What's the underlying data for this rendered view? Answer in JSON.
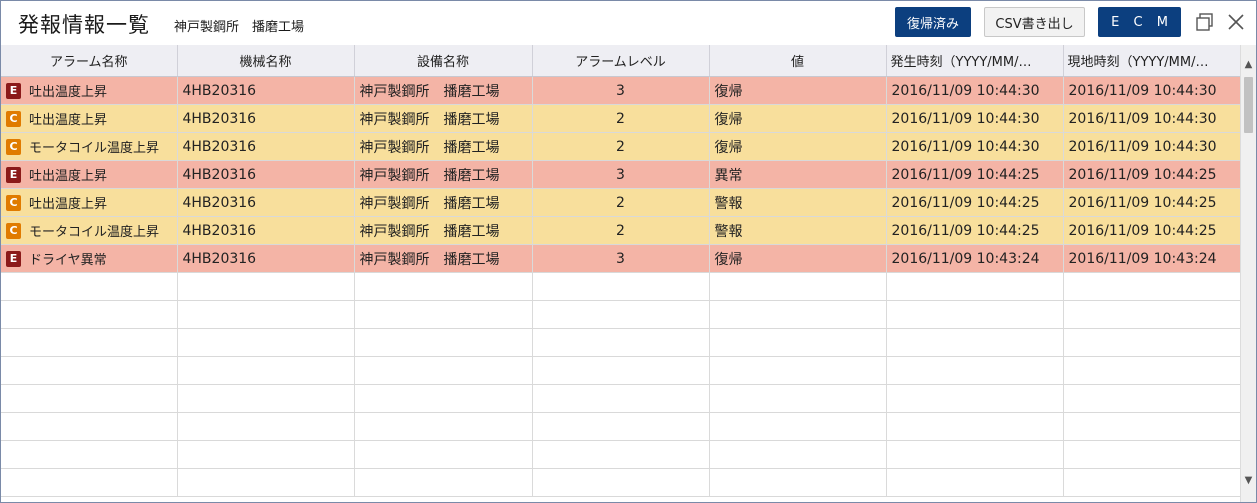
{
  "header": {
    "title": "発報情報一覧",
    "subtitle": "神戸製鋼所　播磨工場",
    "restored_button": "復帰済み",
    "csv_button": "CSV書き出し",
    "ecm": [
      "E",
      "C",
      "M"
    ]
  },
  "columns": [
    "アラーム名称",
    "機械名称",
    "設備名称",
    "アラームレベル",
    "値",
    "発生時刻（YYYY/MM/…",
    "現地時刻（YYYY/MM/…"
  ],
  "rows": [
    {
      "badge": "E",
      "alarm": "吐出温度上昇",
      "machine": "4HB20316",
      "facility": "神戸製鋼所　播磨工場",
      "level": "3",
      "value": "復帰",
      "occurred": "2016/11/09 10:44:30",
      "local": "2016/11/09 10:44:30"
    },
    {
      "badge": "C",
      "alarm": "吐出温度上昇",
      "machine": "4HB20316",
      "facility": "神戸製鋼所　播磨工場",
      "level": "2",
      "value": "復帰",
      "occurred": "2016/11/09 10:44:30",
      "local": "2016/11/09 10:44:30"
    },
    {
      "badge": "C",
      "alarm": "モータコイル温度上昇",
      "machine": "4HB20316",
      "facility": "神戸製鋼所　播磨工場",
      "level": "2",
      "value": "復帰",
      "occurred": "2016/11/09 10:44:30",
      "local": "2016/11/09 10:44:30"
    },
    {
      "badge": "E",
      "alarm": "吐出温度上昇",
      "machine": "4HB20316",
      "facility": "神戸製鋼所　播磨工場",
      "level": "3",
      "value": "異常",
      "occurred": "2016/11/09 10:44:25",
      "local": "2016/11/09 10:44:25"
    },
    {
      "badge": "C",
      "alarm": "吐出温度上昇",
      "machine": "4HB20316",
      "facility": "神戸製鋼所　播磨工場",
      "level": "2",
      "value": "警報",
      "occurred": "2016/11/09 10:44:25",
      "local": "2016/11/09 10:44:25"
    },
    {
      "badge": "C",
      "alarm": "モータコイル温度上昇",
      "machine": "4HB20316",
      "facility": "神戸製鋼所　播磨工場",
      "level": "2",
      "value": "警報",
      "occurred": "2016/11/09 10:44:25",
      "local": "2016/11/09 10:44:25"
    },
    {
      "badge": "E",
      "alarm": "ドライヤ異常",
      "machine": "4HB20316",
      "facility": "神戸製鋼所　播磨工場",
      "level": "3",
      "value": "復帰",
      "occurred": "2016/11/09 10:43:24",
      "local": "2016/11/09 10:43:24"
    }
  ],
  "icons": {
    "restore": "restore-window-icon",
    "close": "close-icon",
    "scroll_up": "chevron-up-icon",
    "scroll_down": "chevron-down-icon"
  },
  "colors": {
    "level_e_row": "#f4b4a6",
    "level_c_row": "#f8df9c",
    "badge_e": "#8b1a1a",
    "badge_c": "#e07b00",
    "accent": "#0c3f7f"
  }
}
